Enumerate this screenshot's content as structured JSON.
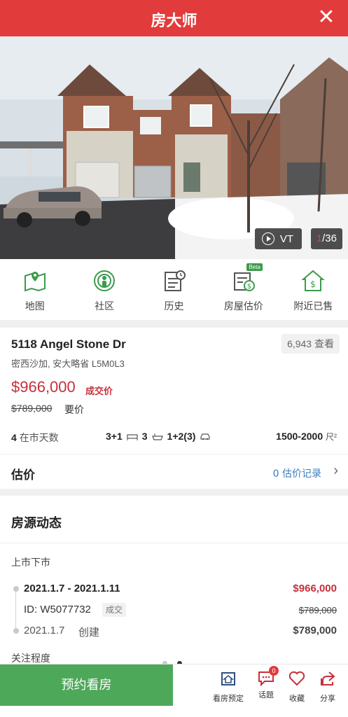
{
  "header": {
    "title": "房大师",
    "close_glyph": "✕"
  },
  "hero": {
    "vt_label": "VT",
    "photo_current": "1",
    "photo_total": "/36"
  },
  "quick_nav": [
    {
      "label": "地图",
      "icon": "map-icon"
    },
    {
      "label": "社区",
      "icon": "community-icon"
    },
    {
      "label": "历史",
      "icon": "history-icon"
    },
    {
      "label": "房屋估价",
      "icon": "valuation-icon",
      "badge": "Beta"
    },
    {
      "label": "附近已售",
      "icon": "nearby-sold-icon"
    }
  ],
  "listing": {
    "address": "5118 Angel Stone Dr",
    "views": "6,943 查看",
    "city": "密西沙加, 安大略省 L5M0L3",
    "sold_price": "$966,000",
    "sold_label": "成交价",
    "ask_price": "$789,000",
    "ask_label": "要价",
    "days_on_market": "4",
    "days_label": "在市天数",
    "bedrooms": "3+1",
    "bathrooms": "3",
    "parking": "1+2(3)",
    "size": "1500-2000",
    "size_unit": "尺²"
  },
  "estimate": {
    "label": "估价",
    "records": "0 估价记录",
    "chevron": "›"
  },
  "dynamics": {
    "title": "房源动态",
    "section": "上市下市",
    "range": "2021.1.7 - 2021.1.11",
    "final_price": "$966,000",
    "id_text": "ID: W5077732",
    "status": "成交",
    "old_price": "$789,000",
    "date": "2021.1.7",
    "action": "创建",
    "list_price": "$789,000",
    "attention": "关注程度"
  },
  "bottom_bar": {
    "book_label": "预约看房",
    "items": [
      {
        "label": "看房预定",
        "icon": "schedule-icon"
      },
      {
        "label": "话题",
        "icon": "topic-icon",
        "badge": "0"
      },
      {
        "label": "收藏",
        "icon": "heart-icon"
      },
      {
        "label": "分享",
        "icon": "share-icon"
      }
    ]
  },
  "colors": {
    "brand_red": "#e23b3b",
    "sold_red": "#c7303a",
    "book_green": "#4ea85a",
    "link_blue": "#3a7bbf"
  }
}
